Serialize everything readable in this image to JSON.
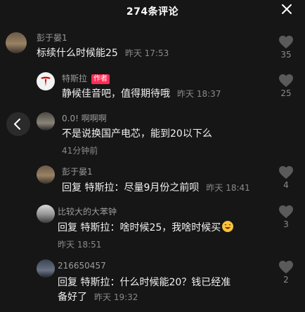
{
  "header": {
    "title": "274条评论",
    "close_icon": "close-icon"
  },
  "back_button": {
    "icon": "chevron-left-icon"
  },
  "comments": [
    {
      "username": "彭于晏1",
      "text": "标续什么时候能25",
      "time": "昨天 17:53",
      "likes": "35",
      "avatar_icon": "avatar-photo"
    },
    {
      "username": "特斯拉",
      "badge": "作者",
      "text": "静候佳音吧，值得期待哦",
      "time": "昨天 18:37",
      "likes": "25",
      "avatar_icon": "tesla-logo"
    },
    {
      "username": "0.0!  啊啊啊",
      "text": "不是说换国产电芯，能到20以下么",
      "time": "41分钟前",
      "likes": "",
      "avatar_icon": "avatar-photo"
    },
    {
      "username": "彭于晏1",
      "reply_prefix": "回复 特斯拉：",
      "text": "尽量9月份之前呗",
      "time": "昨天 18:41",
      "likes": "4",
      "avatar_icon": "avatar-photo"
    },
    {
      "username": "比较大的大苯钟",
      "reply_prefix": "回复 特斯拉：",
      "text": "啥时候25，我啥时候买",
      "time": "昨天 18:51",
      "likes": "3",
      "avatar_icon": "avatar-photo",
      "emoji": "laughing-emoji"
    },
    {
      "username": "216650457",
      "reply_prefix": "回复 特斯拉：",
      "text": "什么时候能20？钱已经准",
      "text_line2": "备好了",
      "time": "昨天 19:32",
      "likes": "2",
      "avatar_icon": "avatar-photo"
    }
  ],
  "colors": {
    "background": "#161616",
    "author_badge": "#fe2c55",
    "muted": "#8a8a8a"
  }
}
